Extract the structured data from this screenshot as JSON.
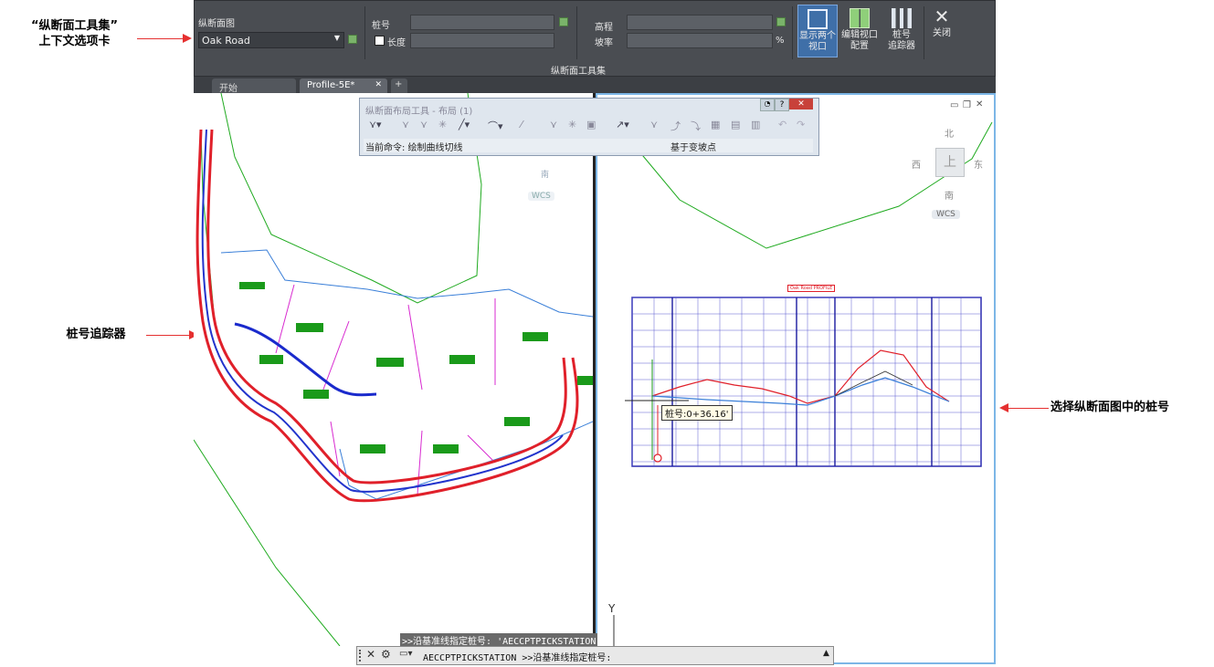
{
  "annotations": {
    "ribbon_tab_line1": "“纵断面工具集”",
    "ribbon_tab_line2": "上下文选项卡",
    "station_tracker": "桩号追踪器",
    "select_station": "选择纵断面图中的桩号"
  },
  "ribbon": {
    "profile_view_label": "纵断面图",
    "profile_view_value": "Oak Road",
    "station_label": "桩号",
    "length_label": "长度",
    "elevation_label": "高程",
    "grade_label": "坡率",
    "grade_unit": "%",
    "panel_title": "纵断面工具集",
    "show_two_views": "显示两个\n视口",
    "edit_viewport": "编辑视口\n配置",
    "station_tracker": "桩号\n追踪器",
    "close": "关闭"
  },
  "tabs": [
    {
      "label": "开始"
    },
    {
      "label": "Profile-5E*"
    },
    {
      "label": "+"
    }
  ],
  "layout_panel": {
    "title": "纵断面布局工具 - 布局 (1)",
    "current_command": "当前命令: 绘制曲线切线",
    "based_on": "基于变坡点"
  },
  "viewcube": {
    "north": "北",
    "south": "南",
    "east": "东",
    "west": "西",
    "face": "上",
    "wcs": "WCS"
  },
  "left_viewcube": {
    "south": "南",
    "wcs": "WCS"
  },
  "profile": {
    "title": "Oak Road PROFILE",
    "station_tooltip": "桩号:0+36.16'"
  },
  "ucs": {
    "y": "Y"
  },
  "command": {
    "history": ">>沿基准线指定桩号: 'AECCPTPICKSTATION",
    "current": "AECCPTPICKSTATION >>沿基准线指定桩号:"
  },
  "colors": {
    "ribbon_bg": "#4a4d52",
    "alignment_red": "#e0202a",
    "parcel_blue": "#3a7fd8",
    "boundary_green": "#1faa1f",
    "lot_magenta": "#d82bd0",
    "annotation_red": "#e53030"
  }
}
